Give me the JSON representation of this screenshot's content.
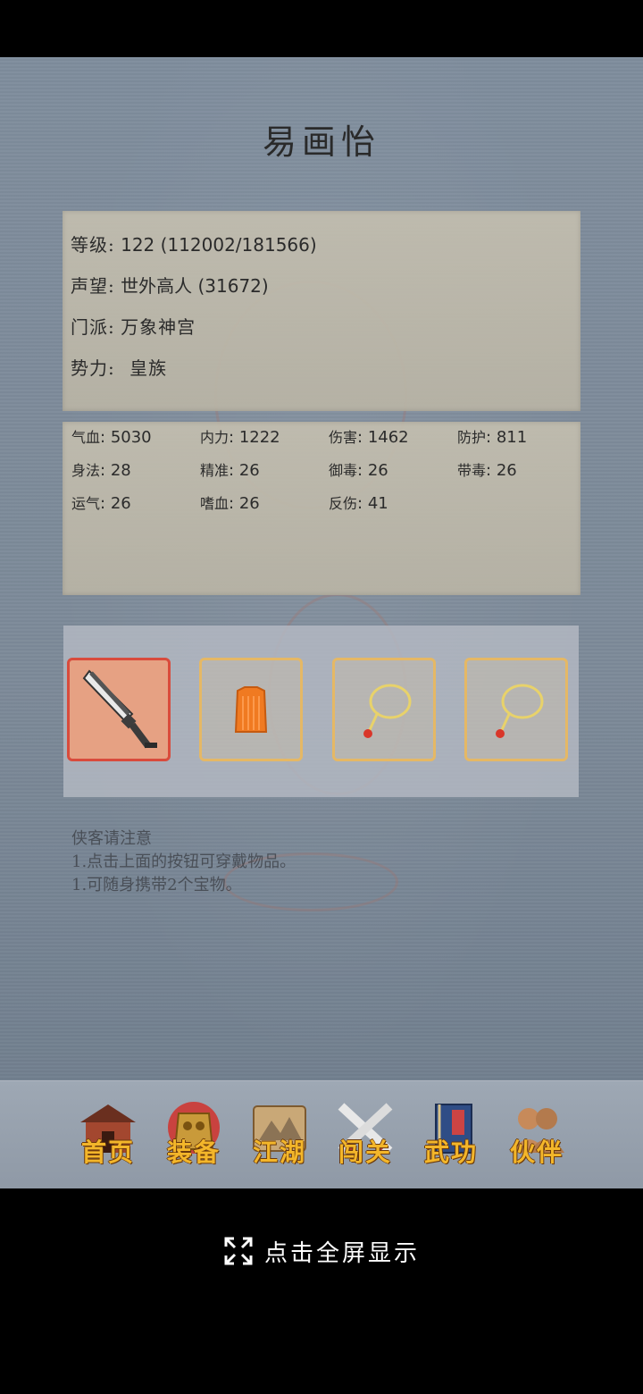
{
  "character_name": "易画怡",
  "info": {
    "level_label": "等级:",
    "level_value": "122 (112002/181566)",
    "reputation_label": "声望:",
    "reputation_value": "世外高人 (31672)",
    "sect_label": "门派:",
    "sect_value": "万象神宫",
    "faction_label": "势力:",
    "faction_value": "皇族"
  },
  "stats": [
    {
      "label": "气血",
      "value": "5030"
    },
    {
      "label": "内力",
      "value": "1222"
    },
    {
      "label": "伤害",
      "value": "1462"
    },
    {
      "label": "防护",
      "value": "811"
    },
    {
      "label": "身法",
      "value": "28"
    },
    {
      "label": "精准",
      "value": "26"
    },
    {
      "label": "御毒",
      "value": "26"
    },
    {
      "label": "带毒",
      "value": "26"
    },
    {
      "label": "运气",
      "value": "26"
    },
    {
      "label": "嗜血",
      "value": "26"
    },
    {
      "label": "反伤",
      "value": "41"
    }
  ],
  "equipment_slots": [
    {
      "item_icon": "broad-sword-icon",
      "selected": true
    },
    {
      "item_icon": "orange-vest-icon",
      "selected": false
    },
    {
      "item_icon": "jade-pendant-icon",
      "selected": false
    },
    {
      "item_icon": "jade-pendant-icon",
      "selected": false
    }
  ],
  "notice": {
    "title": "侠客请注意",
    "lines": [
      "1.点击上面的按钮可穿戴物品。",
      "1.可随身携带2个宝物。"
    ]
  },
  "nav": {
    "items": [
      {
        "label": "首页",
        "icon": "house-icon"
      },
      {
        "label": "装备",
        "icon": "armor-icon"
      },
      {
        "label": "江湖",
        "icon": "scroll-map-icon"
      },
      {
        "label": "闯关",
        "icon": "crossed-swords-icon"
      },
      {
        "label": "武功",
        "icon": "martial-book-icon"
      },
      {
        "label": "伙伴",
        "icon": "companions-icon"
      }
    ]
  },
  "fullscreen": {
    "label": "点击全屏显示",
    "icon": "expand-icon"
  },
  "colors": {
    "background": "#7f8d9d",
    "paper": "#c3beaf",
    "slot_border": "#e5b865",
    "slot_selected_border": "#d94b3c",
    "nav_label": "#f3b62a"
  }
}
